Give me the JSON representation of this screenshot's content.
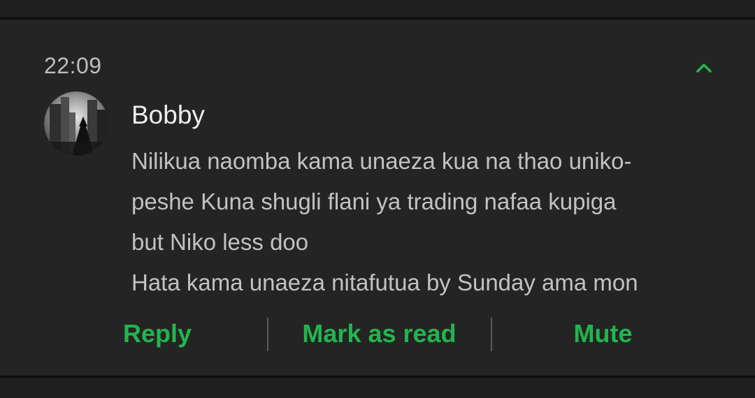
{
  "notification": {
    "time": "22:09",
    "sender": "Bobby",
    "message_lines": [
      "Nilikua naomba kama unaeza kua na thao uniko-",
      "peshe Kuna shugli flani ya trading nafaa kupiga",
      "but Niko less doo",
      "Hata kama unaeza nitafutua by Sunday ama mon"
    ],
    "collapse_icon": "chevron-up-icon",
    "avatar_icon": "contact-avatar-photo"
  },
  "actions": {
    "reply": "Reply",
    "mark_as_read": "Mark as read",
    "mute": "Mute"
  },
  "colors": {
    "background": "#242424",
    "accent": "#22b54f",
    "primary_text": "#eeeeee",
    "secondary_text": "#c2c2c2",
    "divider": "#0f0f0f"
  }
}
